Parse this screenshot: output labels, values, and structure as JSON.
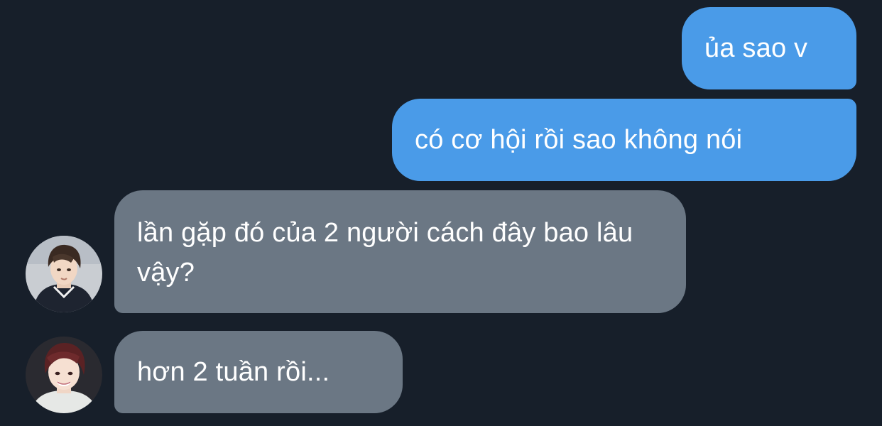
{
  "conversation": {
    "messages": [
      {
        "direction": "sent",
        "text": "ủa sao v"
      },
      {
        "direction": "sent",
        "text": "có cơ hội rồi sao không nói"
      },
      {
        "direction": "received",
        "text": "lần gặp đó của 2 người cách đây bao lâu vậy?",
        "avatar": "avatar-photo"
      },
      {
        "direction": "received",
        "text": "hơn 2 tuần rồi...",
        "avatar": "avatar-photo"
      }
    ]
  },
  "colors": {
    "background": "#171f2a",
    "sent_bubble": "#4a9be8",
    "received_bubble": "#6b7784",
    "text": "#ffffff"
  }
}
